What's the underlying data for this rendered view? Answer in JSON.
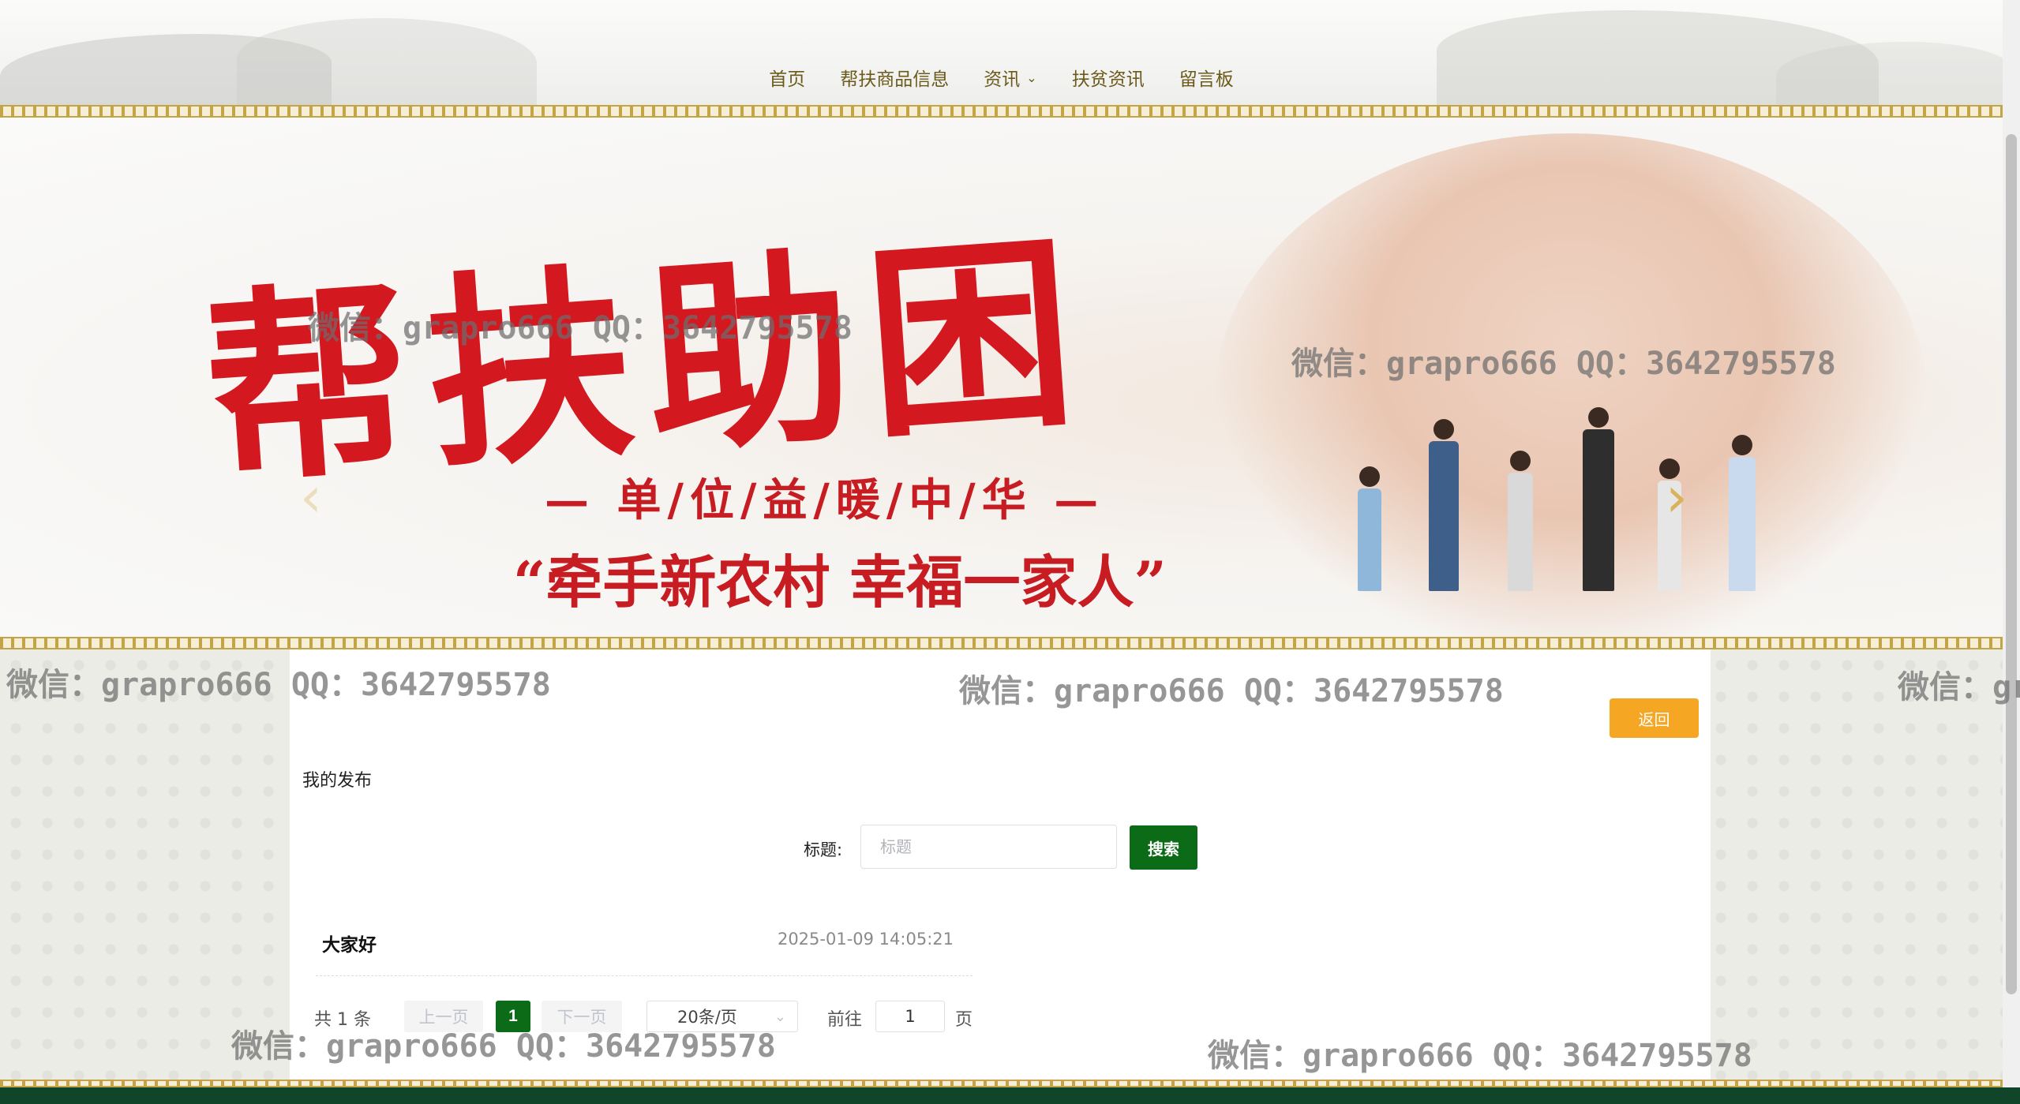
{
  "nav": {
    "items": [
      "首页",
      "帮扶商品信息",
      "资讯",
      "扶贫资讯",
      "留言板"
    ],
    "dropdown_index": 2
  },
  "banner": {
    "title": "帮扶助困",
    "subtitle": "— 单/位/益/暖/中/华 —",
    "slogan": "“牵手新农村 幸福一家人”"
  },
  "page": {
    "back_label": "返回",
    "section_title": "我的发布"
  },
  "search": {
    "label": "标题:",
    "placeholder": "标题",
    "button_label": "搜索"
  },
  "posts": [
    {
      "title": "大家好",
      "time": "2025-01-09 14:05:21"
    }
  ],
  "pagination": {
    "total_text": "共 1 条",
    "prev_label": "上一页",
    "current_page": "1",
    "next_label": "下一页",
    "page_size": "20条/页",
    "goto_label": "前往",
    "goto_value": "1",
    "page_suffix": "页"
  },
  "watermark": "微信：grapro666 QQ：3642795578",
  "colors": {
    "accent_green": "#0c6b17",
    "back_orange": "#f5a623",
    "nav_text": "#6b5a1a",
    "banner_red": "#d41820",
    "footer": "#10452a"
  }
}
